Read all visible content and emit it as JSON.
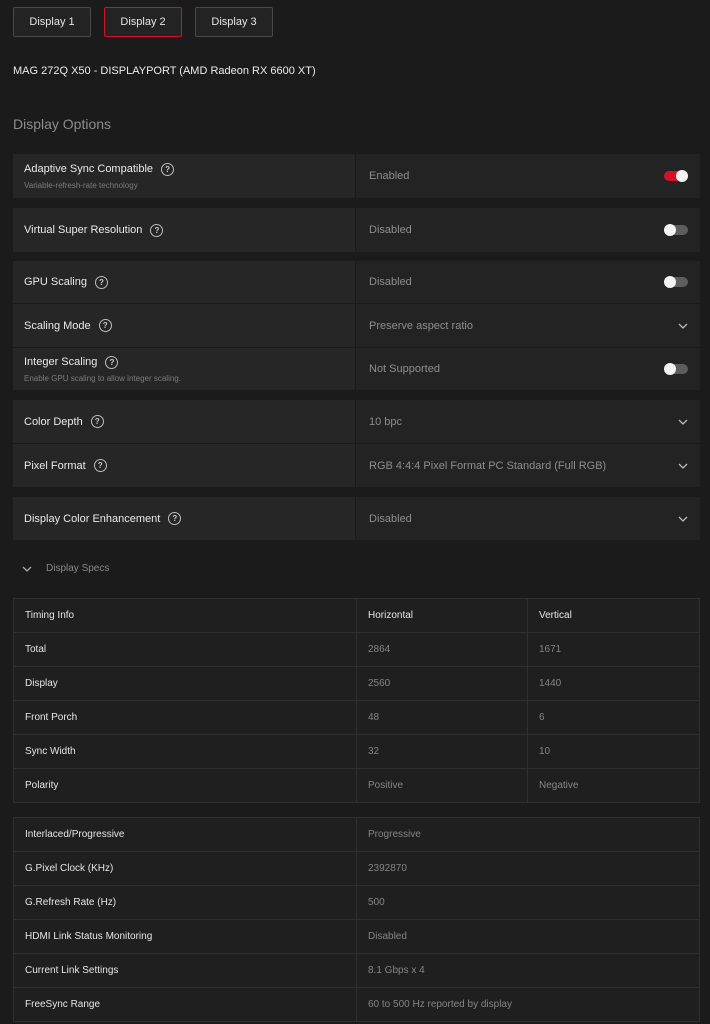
{
  "tabs": [
    {
      "label": "Display 1",
      "active": false
    },
    {
      "label": "Display 2",
      "active": true
    },
    {
      "label": "Display 3",
      "active": false
    }
  ],
  "device_name": "MAG 272Q X50 - DISPLAYPORT (AMD Radeon RX 6600 XT)",
  "section_title": "Display Options",
  "options": {
    "adaptive_sync": {
      "label": "Adaptive Sync Compatible",
      "sub": "Variable-refresh-rate technology",
      "value": "Enabled",
      "toggle": true
    },
    "vsr": {
      "label": "Virtual Super Resolution",
      "value": "Disabled",
      "toggle": false
    },
    "gpu_scaling": {
      "label": "GPU Scaling",
      "value": "Disabled",
      "toggle": false
    },
    "scaling_mode": {
      "label": "Scaling Mode",
      "value": "Preserve aspect ratio"
    },
    "integer_scaling": {
      "label": "Integer Scaling",
      "sub": "Enable GPU scaling to allow integer scaling.",
      "value": "Not Supported",
      "toggle": false
    },
    "color_depth": {
      "label": "Color Depth",
      "value": "10 bpc"
    },
    "pixel_format": {
      "label": "Pixel Format",
      "value": "RGB 4:4:4 Pixel Format PC Standard (Full RGB)"
    },
    "color_enhancement": {
      "label": "Display Color Enhancement",
      "value": "Disabled"
    }
  },
  "specs_toggle_label": "Display Specs",
  "timing": {
    "headers": [
      "Timing Info",
      "Horizontal",
      "Vertical"
    ],
    "rows": [
      [
        "Total",
        "2864",
        "1671"
      ],
      [
        "Display",
        "2560",
        "1440"
      ],
      [
        "Front Porch",
        "48",
        "6"
      ],
      [
        "Sync Width",
        "32",
        "10"
      ],
      [
        "Polarity",
        "Positive",
        "Negative"
      ]
    ]
  },
  "info": {
    "rows": [
      [
        "Interlaced/Progressive",
        "Progressive"
      ],
      [
        "G.Pixel Clock (KHz)",
        "2392870"
      ],
      [
        "G.Refresh Rate (Hz)",
        "500"
      ],
      [
        "HDMI Link Status Monitoring",
        "Disabled"
      ],
      [
        "Current Link Settings",
        "8.1 Gbps x 4"
      ],
      [
        "FreeSync Range",
        "60 to 500 Hz reported by display"
      ]
    ]
  },
  "colors": {
    "accent": "#d3122a",
    "bg": "#1b1b1b",
    "panel": "#262626"
  }
}
